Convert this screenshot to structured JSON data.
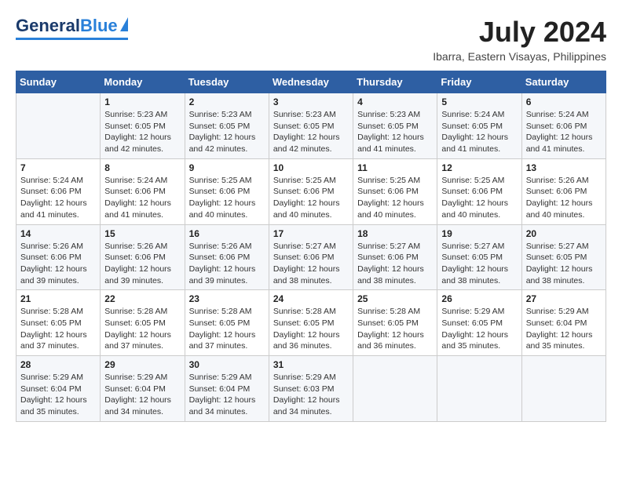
{
  "logo": {
    "general": "General",
    "blue": "Blue"
  },
  "title": {
    "month_year": "July 2024",
    "location": "Ibarra, Eastern Visayas, Philippines"
  },
  "weekdays": [
    "Sunday",
    "Monday",
    "Tuesday",
    "Wednesday",
    "Thursday",
    "Friday",
    "Saturday"
  ],
  "weeks": [
    [
      {
        "day": "",
        "info": ""
      },
      {
        "day": "1",
        "info": "Sunrise: 5:23 AM\nSunset: 6:05 PM\nDaylight: 12 hours\nand 42 minutes."
      },
      {
        "day": "2",
        "info": "Sunrise: 5:23 AM\nSunset: 6:05 PM\nDaylight: 12 hours\nand 42 minutes."
      },
      {
        "day": "3",
        "info": "Sunrise: 5:23 AM\nSunset: 6:05 PM\nDaylight: 12 hours\nand 42 minutes."
      },
      {
        "day": "4",
        "info": "Sunrise: 5:23 AM\nSunset: 6:05 PM\nDaylight: 12 hours\nand 41 minutes."
      },
      {
        "day": "5",
        "info": "Sunrise: 5:24 AM\nSunset: 6:05 PM\nDaylight: 12 hours\nand 41 minutes."
      },
      {
        "day": "6",
        "info": "Sunrise: 5:24 AM\nSunset: 6:06 PM\nDaylight: 12 hours\nand 41 minutes."
      }
    ],
    [
      {
        "day": "7",
        "info": "Sunrise: 5:24 AM\nSunset: 6:06 PM\nDaylight: 12 hours\nand 41 minutes."
      },
      {
        "day": "8",
        "info": "Sunrise: 5:24 AM\nSunset: 6:06 PM\nDaylight: 12 hours\nand 41 minutes."
      },
      {
        "day": "9",
        "info": "Sunrise: 5:25 AM\nSunset: 6:06 PM\nDaylight: 12 hours\nand 40 minutes."
      },
      {
        "day": "10",
        "info": "Sunrise: 5:25 AM\nSunset: 6:06 PM\nDaylight: 12 hours\nand 40 minutes."
      },
      {
        "day": "11",
        "info": "Sunrise: 5:25 AM\nSunset: 6:06 PM\nDaylight: 12 hours\nand 40 minutes."
      },
      {
        "day": "12",
        "info": "Sunrise: 5:25 AM\nSunset: 6:06 PM\nDaylight: 12 hours\nand 40 minutes."
      },
      {
        "day": "13",
        "info": "Sunrise: 5:26 AM\nSunset: 6:06 PM\nDaylight: 12 hours\nand 40 minutes."
      }
    ],
    [
      {
        "day": "14",
        "info": "Sunrise: 5:26 AM\nSunset: 6:06 PM\nDaylight: 12 hours\nand 39 minutes."
      },
      {
        "day": "15",
        "info": "Sunrise: 5:26 AM\nSunset: 6:06 PM\nDaylight: 12 hours\nand 39 minutes."
      },
      {
        "day": "16",
        "info": "Sunrise: 5:26 AM\nSunset: 6:06 PM\nDaylight: 12 hours\nand 39 minutes."
      },
      {
        "day": "17",
        "info": "Sunrise: 5:27 AM\nSunset: 6:06 PM\nDaylight: 12 hours\nand 38 minutes."
      },
      {
        "day": "18",
        "info": "Sunrise: 5:27 AM\nSunset: 6:06 PM\nDaylight: 12 hours\nand 38 minutes."
      },
      {
        "day": "19",
        "info": "Sunrise: 5:27 AM\nSunset: 6:05 PM\nDaylight: 12 hours\nand 38 minutes."
      },
      {
        "day": "20",
        "info": "Sunrise: 5:27 AM\nSunset: 6:05 PM\nDaylight: 12 hours\nand 38 minutes."
      }
    ],
    [
      {
        "day": "21",
        "info": "Sunrise: 5:28 AM\nSunset: 6:05 PM\nDaylight: 12 hours\nand 37 minutes."
      },
      {
        "day": "22",
        "info": "Sunrise: 5:28 AM\nSunset: 6:05 PM\nDaylight: 12 hours\nand 37 minutes."
      },
      {
        "day": "23",
        "info": "Sunrise: 5:28 AM\nSunset: 6:05 PM\nDaylight: 12 hours\nand 37 minutes."
      },
      {
        "day": "24",
        "info": "Sunrise: 5:28 AM\nSunset: 6:05 PM\nDaylight: 12 hours\nand 36 minutes."
      },
      {
        "day": "25",
        "info": "Sunrise: 5:28 AM\nSunset: 6:05 PM\nDaylight: 12 hours\nand 36 minutes."
      },
      {
        "day": "26",
        "info": "Sunrise: 5:29 AM\nSunset: 6:05 PM\nDaylight: 12 hours\nand 35 minutes."
      },
      {
        "day": "27",
        "info": "Sunrise: 5:29 AM\nSunset: 6:04 PM\nDaylight: 12 hours\nand 35 minutes."
      }
    ],
    [
      {
        "day": "28",
        "info": "Sunrise: 5:29 AM\nSunset: 6:04 PM\nDaylight: 12 hours\nand 35 minutes."
      },
      {
        "day": "29",
        "info": "Sunrise: 5:29 AM\nSunset: 6:04 PM\nDaylight: 12 hours\nand 34 minutes."
      },
      {
        "day": "30",
        "info": "Sunrise: 5:29 AM\nSunset: 6:04 PM\nDaylight: 12 hours\nand 34 minutes."
      },
      {
        "day": "31",
        "info": "Sunrise: 5:29 AM\nSunset: 6:03 PM\nDaylight: 12 hours\nand 34 minutes."
      },
      {
        "day": "",
        "info": ""
      },
      {
        "day": "",
        "info": ""
      },
      {
        "day": "",
        "info": ""
      }
    ]
  ]
}
